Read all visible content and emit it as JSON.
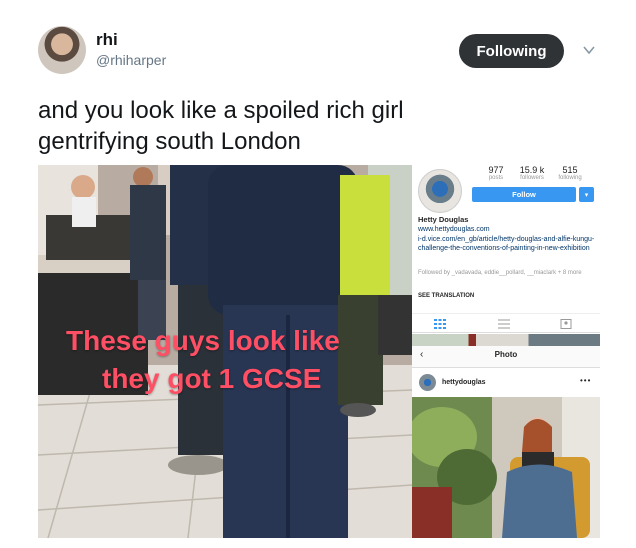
{
  "tweet": {
    "author_name": "rhi",
    "author_handle": "@rhiharper",
    "follow_label": "Following",
    "text_line1": "and you look like a spoiled rich girl",
    "text_line2": "gentrifying south London"
  },
  "photo_left": {
    "caption_line1": "These guys look like",
    "caption_line2": "they got 1 GCSE",
    "caption_color": "#ff4f64"
  },
  "instagram": {
    "stats": [
      {
        "number": "977",
        "label": "posts"
      },
      {
        "number": "15.9 k",
        "label": "followers"
      },
      {
        "number": "515",
        "label": "following"
      }
    ],
    "follow_label": "Follow",
    "dropdown_glyph": "▾",
    "bio_name": "Hetty Douglas",
    "bio_website": "www.hettydouglas.com",
    "bio_link": "i-d.vice.com/en_gb/article/hetty-douglas-and-alfie-kungu-challenge-the-conventions-of-painting-in-new-exhibition",
    "followed_by": "Followed by _vadavada, eddie__pollard, __miaclark + 8 more",
    "see_translation": "SEE TRANSLATION",
    "nav_title": "Photo",
    "post_username": "hettydouglas",
    "post_more": "•••",
    "accent": "#3897f0"
  },
  "icons": {
    "chevron": "chevron-down-icon",
    "grid": "grid-icon",
    "list": "list-icon",
    "tagged": "tagged-icon",
    "back": "back-arrow-icon"
  }
}
